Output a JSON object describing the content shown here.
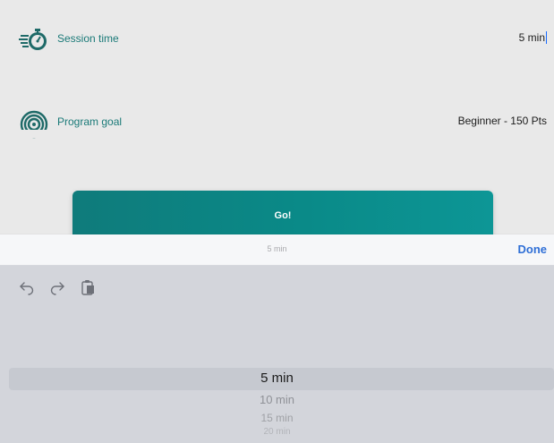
{
  "settings": {
    "session_time": {
      "label": "Session time",
      "value": "5 min",
      "icon": "stopwatch-icon"
    },
    "program_goal": {
      "label": "Program goal",
      "value": "Beginner - 150 Pts",
      "icon": "target-rings-icon"
    }
  },
  "go_button": {
    "label": "Go!"
  },
  "accessory_bar": {
    "current_value": "5 min",
    "done_label": "Done"
  },
  "toolbar": {
    "icons": [
      "undo-icon",
      "redo-icon",
      "paste-icon"
    ]
  },
  "picker": {
    "options": [
      "5 min",
      "10 min",
      "15 min",
      "20 min"
    ],
    "selected": "5 min"
  },
  "colors": {
    "accent_teal": "#0a8a88",
    "label_teal": "#1b7a78",
    "done_blue": "#2f6fd6"
  }
}
